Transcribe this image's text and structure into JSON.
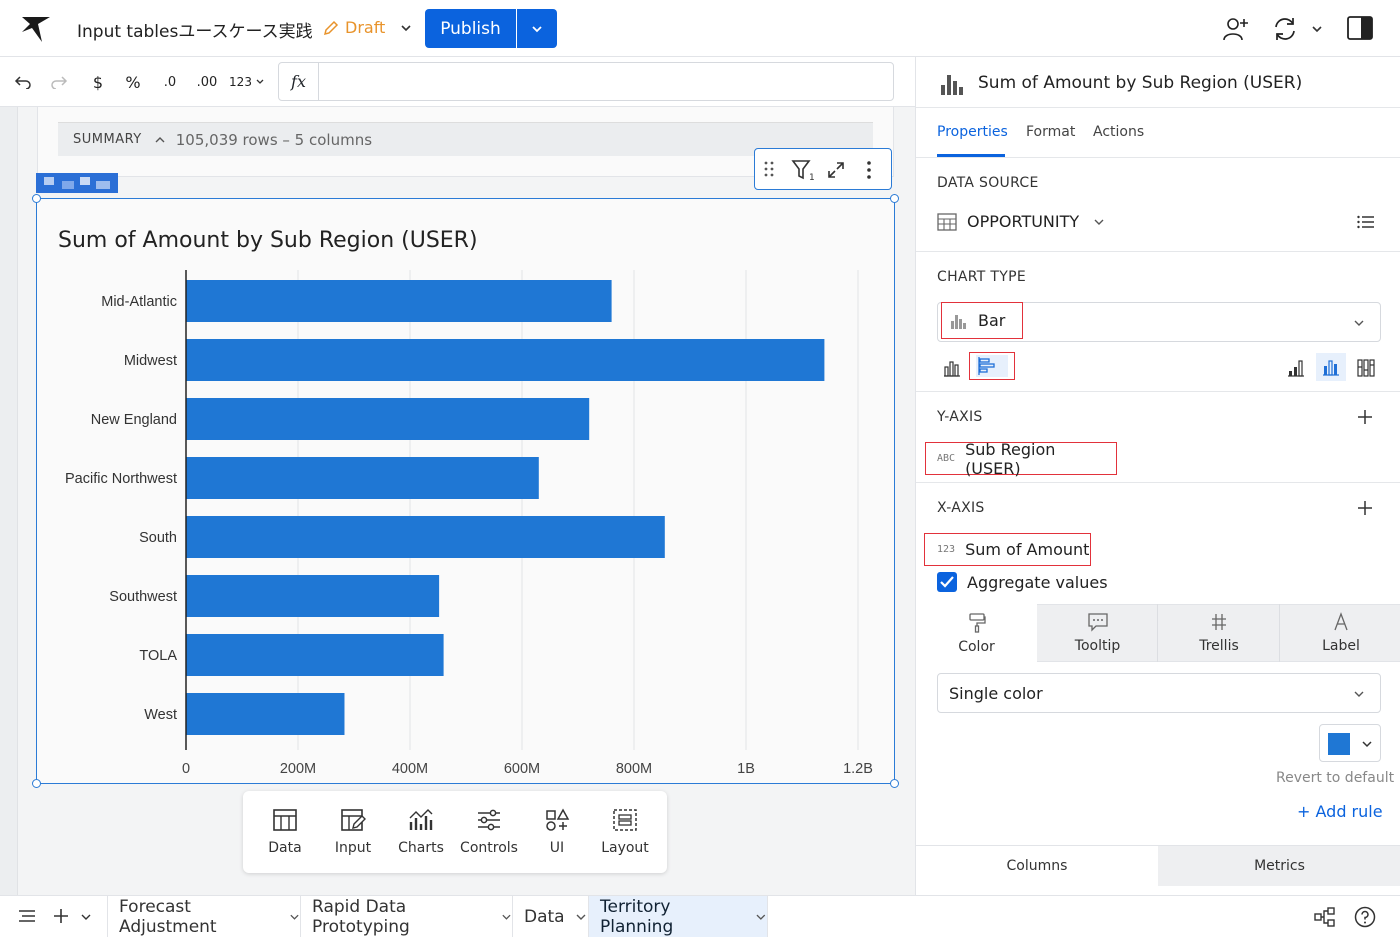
{
  "header": {
    "doc_title": "Input tablesユースケース実践",
    "draft_label": "Draft",
    "publish_label": "Publish"
  },
  "toolbar": {
    "currency": "$",
    "percent": "%",
    "decrease_decimal": ".0",
    "increase_decimal": ".00",
    "number_format": "123",
    "formula_symbol": "fx",
    "formula_value": ""
  },
  "table": {
    "summary_label": "SUMMARY",
    "summary_count": "105,039 rows – 5 columns"
  },
  "chart_data": {
    "type": "bar",
    "orientation": "horizontal",
    "title": "Sum of Amount by Sub Region (USER)",
    "categories": [
      "Mid-Atlantic",
      "Midwest",
      "New England",
      "Pacific Northwest",
      "South",
      "Southwest",
      "TOLA",
      "West"
    ],
    "values": [
      760,
      1140,
      720,
      630,
      855,
      452,
      460,
      283
    ],
    "value_unit": "M",
    "xlim": [
      0,
      1200
    ],
    "ticks": [
      0,
      200,
      400,
      600,
      800,
      1000,
      1200
    ],
    "tick_labels": [
      "0",
      "200M",
      "400M",
      "600M",
      "800M",
      "1B",
      "1.2B"
    ],
    "grid": true,
    "bar_color": "#1f77d4",
    "xlabel": "",
    "ylabel": ""
  },
  "element_bar": {
    "items": [
      {
        "label": "Data",
        "icon": "table-icon"
      },
      {
        "label": "Input",
        "icon": "input-icon"
      },
      {
        "label": "Charts",
        "icon": "charts-icon"
      },
      {
        "label": "Controls",
        "icon": "controls-icon"
      },
      {
        "label": "UI",
        "icon": "ui-icon"
      },
      {
        "label": "Layout",
        "icon": "layout-icon"
      }
    ]
  },
  "panel": {
    "title": "Sum of Amount by Sub Region (USER)",
    "tabs": {
      "properties": "Properties",
      "format": "Format",
      "actions": "Actions"
    },
    "data_source_label": "DATA SOURCE",
    "data_source_value": "OPPORTUNITY",
    "chart_type_label": "CHART TYPE",
    "chart_type_value": "Bar",
    "y_axis_label": "Y-AXIS",
    "y_axis_type": "ABC",
    "y_axis_field": "Sub Region (USER)",
    "x_axis_label": "X-AXIS",
    "x_axis_type": "123",
    "x_axis_field": "Sum of Amount",
    "aggregate_label": "Aggregate values",
    "aggregate_checked": true,
    "mark_tabs": {
      "color": "Color",
      "tooltip": "Tooltip",
      "trellis": "Trellis",
      "label": "Label"
    },
    "color_mode": "Single color",
    "swatch_color": "#1f77d4",
    "revert_label": "Revert to default",
    "add_rule_label": "+ Add rule",
    "bottom_tabs": {
      "columns": "Columns",
      "metrics": "Metrics"
    }
  },
  "bottom": {
    "pages": [
      {
        "label": "Forecast Adjustment",
        "active": false
      },
      {
        "label": "Rapid Data Prototyping",
        "active": false
      },
      {
        "label": "Data",
        "active": false
      },
      {
        "label": "Territory Planning",
        "active": true
      }
    ]
  }
}
